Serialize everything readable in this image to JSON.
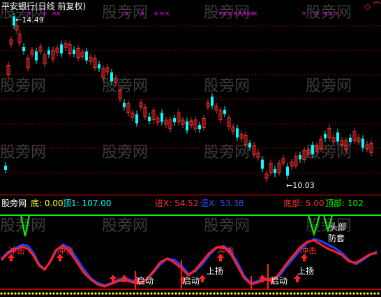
{
  "upper_panel": {
    "title": "平安银行(日线 前复权)",
    "high_label": "14.49",
    "low_label": "10.03",
    "corner_controls": [
      "◇",
      "⌒"
    ]
  },
  "indicator_header": {
    "prefix": "股旁网",
    "items": [
      {
        "label": "底",
        "value": "0.00",
        "color": "#ffff00"
      },
      {
        "label": "顶1",
        "value": "107.00",
        "color": "#00ffff"
      },
      {
        "label": "进X",
        "value": "54.52",
        "color": "#ff3030"
      },
      {
        "label": "退X",
        "value": "53.38",
        "color": "#3050ff"
      },
      {
        "label": "底部",
        "value": "5.00",
        "color": "#ff3030"
      },
      {
        "label": "顶部",
        "value": "102",
        "color": "#00ff00"
      }
    ]
  },
  "signals": {
    "chongji": "冲击",
    "qidong": "启动",
    "shangyang": "上扬",
    "toubu": "头部",
    "fangtao": "防套"
  },
  "watermark": "股旁网",
  "colors": {
    "up": "#ff3030",
    "down": "#00ffff",
    "line_red": "#ff2020",
    "line_blue": "#2040ff",
    "top_line": "#00ff00",
    "grid": "#a00000",
    "marker": "#ff00ff",
    "dots": "#ffff00"
  },
  "chart_data": {
    "type": "candlestick",
    "series_note": "daily candles, price-adjusted",
    "ylim": [
      9.8,
      14.6
    ],
    "candles": []
  }
}
